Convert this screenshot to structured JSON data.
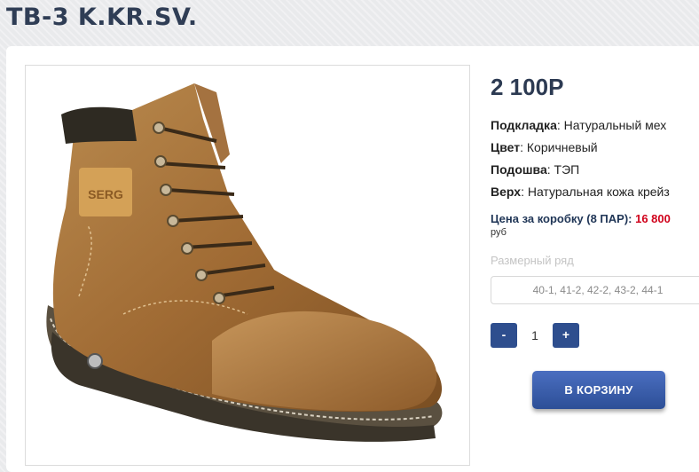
{
  "page": {
    "title": "ТВ-3 K.KR.SV."
  },
  "product": {
    "price": "2 100Р",
    "image_brand_text": "SERG",
    "properties": [
      {
        "label": "Подкладка",
        "value": "Натуральный мех"
      },
      {
        "label": "Цвет",
        "value": "Коричневый"
      },
      {
        "label": "Подошва",
        "value": "ТЭП"
      },
      {
        "label": "Верх",
        "value": "Натуральная кожа крейз"
      }
    ],
    "box_price": {
      "label": "Цена за коробку (8 ПАР):",
      "amount": "16 800",
      "unit": "руб"
    },
    "size_range": {
      "label": "Размерный ряд",
      "selected": "40-1, 41-2, 42-2, 43-2, 44-1"
    },
    "quantity": {
      "minus_label": "-",
      "value": "1",
      "plus_label": "+"
    },
    "cart_button_label": "В КОРЗИНУ"
  },
  "colors": {
    "accent": "#2e4e8e",
    "title": "#2f3d55",
    "price_highlight": "#d0021b"
  }
}
